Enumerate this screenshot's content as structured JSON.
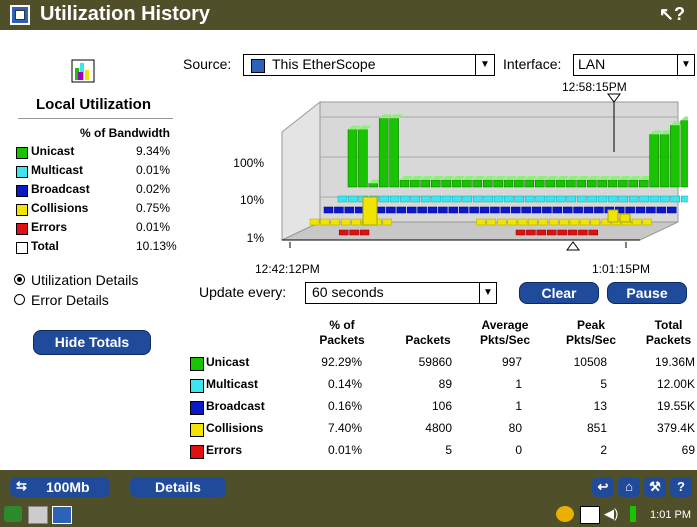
{
  "window": {
    "title": "Utilization History"
  },
  "local": {
    "title": "Local Utilization",
    "bw_header": "% of Bandwidth",
    "rows": [
      {
        "label": "Unicast",
        "value": "9.34%",
        "color": "#18c400"
      },
      {
        "label": "Multicast",
        "value": "0.01%",
        "color": "#3ee4ee"
      },
      {
        "label": "Broadcast",
        "value": "0.02%",
        "color": "#0a18c8"
      },
      {
        "label": "Collisions",
        "value": "0.75%",
        "color": "#f0e400"
      },
      {
        "label": "Errors",
        "value": "0.01%",
        "color": "#e01010"
      },
      {
        "label": "Total",
        "value": "10.13%",
        "color": "#ffffff"
      }
    ]
  },
  "view_options": [
    {
      "label": "Utilization Details",
      "selected": true
    },
    {
      "label": "Error Details",
      "selected": false
    }
  ],
  "buttons": {
    "hide_totals": "Hide Totals",
    "clear": "Clear",
    "pause": "Pause",
    "speed": "100Mb",
    "details": "Details"
  },
  "source": {
    "label": "Source:",
    "value": "This EtherScope"
  },
  "interface": {
    "label": "Interface:",
    "value": "LAN"
  },
  "times": {
    "top_marker": "12:58:15PM",
    "start": "12:42:12PM",
    "end": "1:01:15PM"
  },
  "update": {
    "label": "Update every:",
    "value": "60 seconds"
  },
  "chart_data": {
    "type": "bar",
    "y_tick_labels": [
      "1%",
      "10%",
      "100%"
    ],
    "y_scale": "log",
    "x_start": "12:42:12PM",
    "x_end": "1:01:15PM",
    "series_colors": {
      "Unicast": "#18c400",
      "Multicast": "#3ee4ee",
      "Broadcast": "#0a18c8",
      "Collisions": "#f0e400",
      "Errors": "#e01010"
    },
    "unicast_levels": [
      0.82,
      0.82,
      0.05,
      0.98,
      0.98,
      0.1,
      0.1,
      0.1,
      0.1,
      0.1,
      0.1,
      0.1,
      0.1,
      0.1,
      0.1,
      0.1,
      0.1,
      0.1,
      0.1,
      0.1,
      0.1,
      0.1,
      0.1,
      0.1,
      0.1,
      0.1,
      0.1,
      0.1,
      0.1,
      0.75,
      0.75,
      0.88,
      0.95,
      0.82
    ]
  },
  "table": {
    "headers": [
      "% of Packets",
      "Packets",
      "Average Pkts/Sec",
      "Peak Pkts/Sec",
      "Total Packets"
    ],
    "rows": [
      {
        "label": "Unicast",
        "color": "#18c400",
        "cells": [
          "92.29%",
          "59860",
          "997",
          "10508",
          "19.36M"
        ]
      },
      {
        "label": "Multicast",
        "color": "#3ee4ee",
        "cells": [
          "0.14%",
          "89",
          "1",
          "5",
          "12.00K"
        ]
      },
      {
        "label": "Broadcast",
        "color": "#0a18c8",
        "cells": [
          "0.16%",
          "106",
          "1",
          "13",
          "19.55K"
        ]
      },
      {
        "label": "Collisions",
        "color": "#f0e400",
        "cells": [
          "7.40%",
          "4800",
          "80",
          "851",
          "379.4K"
        ]
      },
      {
        "label": "Errors",
        "color": "#e01010",
        "cells": [
          "0.01%",
          "5",
          "0",
          "2",
          "69"
        ]
      }
    ]
  },
  "clock": "1:01 PM"
}
